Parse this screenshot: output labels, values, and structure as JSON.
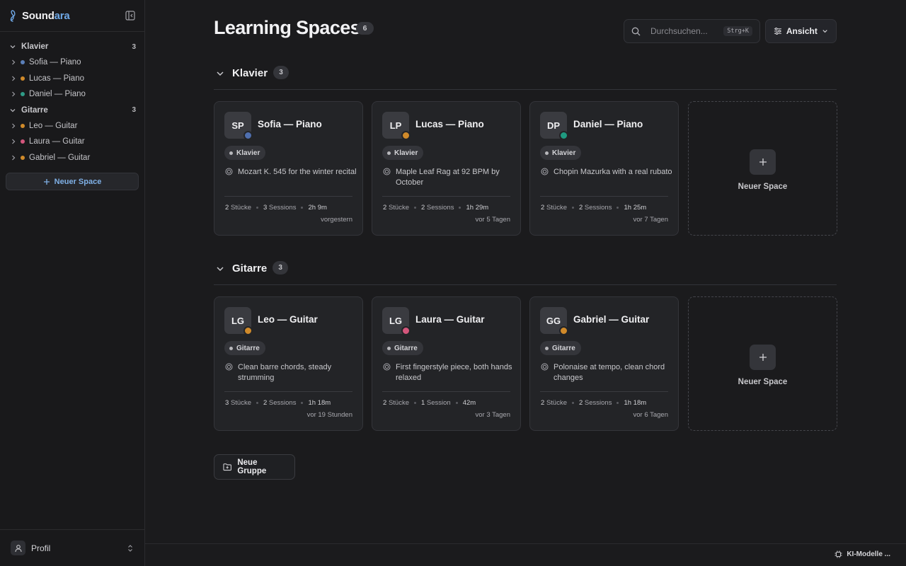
{
  "app": {
    "brand_prefix": "Sound",
    "brand_suffix": "ara"
  },
  "sidebar": {
    "groups": [
      {
        "label": "Klavier",
        "count": "3",
        "items": [
          {
            "label": "Sofia — Piano",
            "color": "#5b7fb8"
          },
          {
            "label": "Lucas — Piano",
            "color": "#d08a2a"
          },
          {
            "label": "Daniel — Piano",
            "color": "#2e9b86"
          }
        ]
      },
      {
        "label": "Gitarre",
        "count": "3",
        "items": [
          {
            "label": "Leo — Guitar",
            "color": "#d08a2a"
          },
          {
            "label": "Laura — Guitar",
            "color": "#d4567c"
          },
          {
            "label": "Gabriel — Guitar",
            "color": "#d08a2a"
          }
        ]
      }
    ],
    "new_space_label": "Neuer Space",
    "profile_label": "Profil"
  },
  "header": {
    "title": "Learning Spaces",
    "count": "6",
    "search_placeholder": "Durchsuchen...",
    "search_shortcut": "Strg+K",
    "view_label": "Ansicht"
  },
  "sections": [
    {
      "title": "Klavier",
      "count": "3",
      "add_label": "Neuer Space",
      "cards": [
        {
          "initials": "SP",
          "name": "Sofia — Piano",
          "status_color": "#4f6fae",
          "tag": "Klavier",
          "goal": "Mozart K. 545 for the winter recital",
          "pieces_n": "2",
          "pieces_l": "Stücke",
          "sessions_n": "3",
          "sessions_l": "Sessions",
          "duration": "2h 9m",
          "last": "vorgestern"
        },
        {
          "initials": "LP",
          "name": "Lucas — Piano",
          "status_color": "#d08a2a",
          "tag": "Klavier",
          "goal": "Maple Leaf Rag at 92 BPM by October",
          "pieces_n": "2",
          "pieces_l": "Stücke",
          "sessions_n": "2",
          "sessions_l": "Sessions",
          "duration": "1h 29m",
          "last": "vor 5 Tagen"
        },
        {
          "initials": "DP",
          "name": "Daniel — Piano",
          "status_color": "#1f9a80",
          "tag": "Klavier",
          "goal": "Chopin Mazurka with a real rubato",
          "pieces_n": "2",
          "pieces_l": "Stücke",
          "sessions_n": "2",
          "sessions_l": "Sessions",
          "duration": "1h 25m",
          "last": "vor 7 Tagen"
        }
      ]
    },
    {
      "title": "Gitarre",
      "count": "3",
      "add_label": "Neuer Space",
      "cards": [
        {
          "initials": "LG",
          "name": "Leo — Guitar",
          "status_color": "#d08a2a",
          "tag": "Gitarre",
          "goal": "Clean barre chords, steady strumming",
          "pieces_n": "3",
          "pieces_l": "Stücke",
          "sessions_n": "2",
          "sessions_l": "Sessions",
          "duration": "1h 18m",
          "last": "vor 19 Stunden"
        },
        {
          "initials": "LG",
          "name": "Laura — Guitar",
          "status_color": "#d4567c",
          "tag": "Gitarre",
          "goal": "First fingerstyle piece, both hands relaxed",
          "pieces_n": "2",
          "pieces_l": "Stücke",
          "sessions_n": "1",
          "sessions_l": "Session",
          "duration": "42m",
          "last": "vor 3 Tagen"
        },
        {
          "initials": "GG",
          "name": "Gabriel — Guitar",
          "status_color": "#d08a2a",
          "tag": "Gitarre",
          "goal": "Polonaise at tempo, clean chord changes",
          "pieces_n": "2",
          "pieces_l": "Stücke",
          "sessions_n": "2",
          "sessions_l": "Sessions",
          "duration": "1h 18m",
          "last": "vor 6 Tagen"
        }
      ]
    }
  ],
  "new_group_label": "Neue Gruppe",
  "footer": {
    "ai_models_label": "KI-Modelle ..."
  }
}
